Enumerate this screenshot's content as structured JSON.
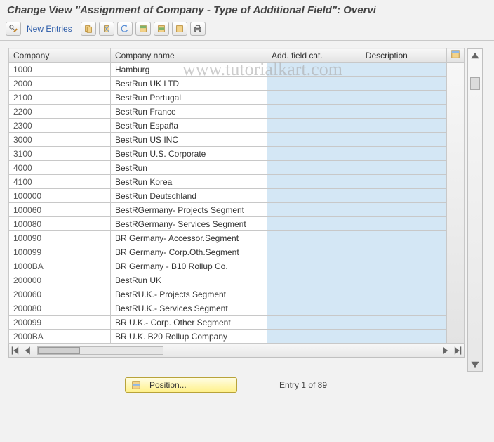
{
  "header": {
    "title": "Change View \"Assignment of Company - Type of Additional Field\": Overvi"
  },
  "toolbar": {
    "new_entries_label": "New Entries"
  },
  "watermark": "www.tutorialkart.com",
  "columns": {
    "c1": "Company",
    "c2": "Company name",
    "c3": "Add. field cat.",
    "c4": "Description"
  },
  "rows": [
    {
      "code": "1000",
      "name": "Hamburg",
      "fc": "",
      "desc": ""
    },
    {
      "code": "2000",
      "name": "BestRun UK LTD",
      "fc": "",
      "desc": ""
    },
    {
      "code": "2100",
      "name": "BestRun Portugal",
      "fc": "",
      "desc": ""
    },
    {
      "code": "2200",
      "name": "BestRun France",
      "fc": "",
      "desc": ""
    },
    {
      "code": "2300",
      "name": "BestRun España",
      "fc": "",
      "desc": ""
    },
    {
      "code": "3000",
      "name": "BestRun US INC",
      "fc": "",
      "desc": ""
    },
    {
      "code": "3100",
      "name": "BestRun U.S. Corporate",
      "fc": "",
      "desc": ""
    },
    {
      "code": "4000",
      "name": "BestRun",
      "fc": "",
      "desc": ""
    },
    {
      "code": "4100",
      "name": "BestRun Korea",
      "fc": "",
      "desc": ""
    },
    {
      "code": "100000",
      "name": "BestRun Deutschland",
      "fc": "",
      "desc": ""
    },
    {
      "code": "100060",
      "name": "BestRGermany- Projects Segment",
      "fc": "",
      "desc": ""
    },
    {
      "code": "100080",
      "name": "BestRGermany- Services Segment",
      "fc": "",
      "desc": ""
    },
    {
      "code": "100090",
      "name": "BR Germany- Accessor.Segment",
      "fc": "",
      "desc": ""
    },
    {
      "code": "100099",
      "name": "BR Germany- Corp.Oth.Segment",
      "fc": "",
      "desc": ""
    },
    {
      "code": "1000BA",
      "name": "BR Germany - B10 Rollup Co.",
      "fc": "",
      "desc": ""
    },
    {
      "code": "200000",
      "name": "BestRun UK",
      "fc": "",
      "desc": ""
    },
    {
      "code": "200060",
      "name": "BestRU.K.-    Projects Segment",
      "fc": "",
      "desc": ""
    },
    {
      "code": "200080",
      "name": "BestRU.K.-    Services Segment",
      "fc": "",
      "desc": ""
    },
    {
      "code": "200099",
      "name": "BR U.K.- Corp. Other Segment",
      "fc": "",
      "desc": ""
    },
    {
      "code": "2000BA",
      "name": "BR  U.K. B20 Rollup Company",
      "fc": "",
      "desc": ""
    }
  ],
  "footer": {
    "position_label": "Position...",
    "entry_count": "Entry 1 of 89"
  }
}
